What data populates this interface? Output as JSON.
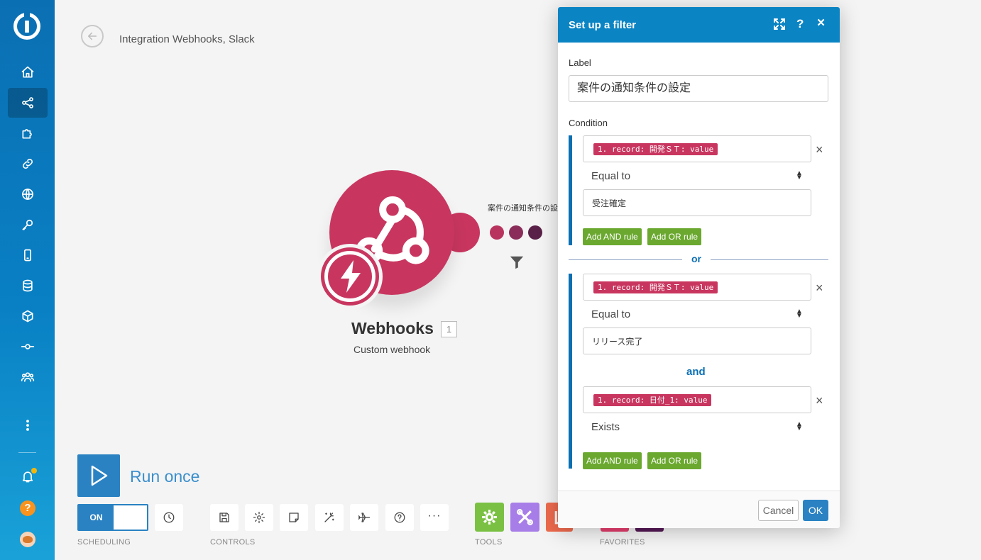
{
  "breadcrumb": "Integration Webhooks, Slack",
  "sidebar": {
    "items": [
      {
        "name": "home-icon"
      },
      {
        "name": "scenarios-icon"
      },
      {
        "name": "apps-puzzle-icon"
      },
      {
        "name": "connections-link-icon"
      },
      {
        "name": "webhooks-globe-icon"
      },
      {
        "name": "keys-icon"
      },
      {
        "name": "devices-icon"
      },
      {
        "name": "datastores-icon"
      },
      {
        "name": "data-structures-cube-icon"
      },
      {
        "name": "custom-apps-icon"
      },
      {
        "name": "team-icon"
      },
      {
        "name": "more-icon"
      },
      {
        "name": "notifications-bell-icon"
      },
      {
        "name": "help-icon"
      },
      {
        "name": "avatar-icon"
      }
    ],
    "help_glyph": "?"
  },
  "module": {
    "title": "Webhooks",
    "number": "1",
    "subtitle": "Custom webhook",
    "color": "#c8365f"
  },
  "route": {
    "label": "案件の通知条件の設定"
  },
  "controls": {
    "run_label": "Run once",
    "toggle_label": "ON",
    "scheduling_label": "SCHEDULING",
    "controls_label": "CONTROLS",
    "tools_label": "TOOLS",
    "favorites_label": "FAVORITES",
    "more_glyph": "···"
  },
  "modal": {
    "title": "Set up a filter",
    "help_glyph": "?",
    "close_glyph": "×",
    "label_caption": "Label",
    "label_value": "案件の通知条件の設定",
    "condition_caption": "Condition",
    "or_text": "or",
    "and_text": "and",
    "remove_glyph": "×",
    "add_and": "Add AND rule",
    "add_or": "Add OR rule",
    "cancel": "Cancel",
    "ok": "OK",
    "groups": [
      {
        "rules": [
          {
            "field": "1. record: 開発ＳＴ: value",
            "operator": "Equal to",
            "value": "受注確定"
          }
        ]
      },
      {
        "rules": [
          {
            "field": "1. record: 開発ＳＴ: value",
            "operator": "Equal to",
            "value": "リリース完了"
          },
          {
            "field": "1. record: 日付_1: value",
            "operator": "Exists"
          }
        ]
      }
    ]
  },
  "colors": {
    "accent": "#0b84c4",
    "pill": "#c8365f",
    "green": "#6aa82f"
  }
}
